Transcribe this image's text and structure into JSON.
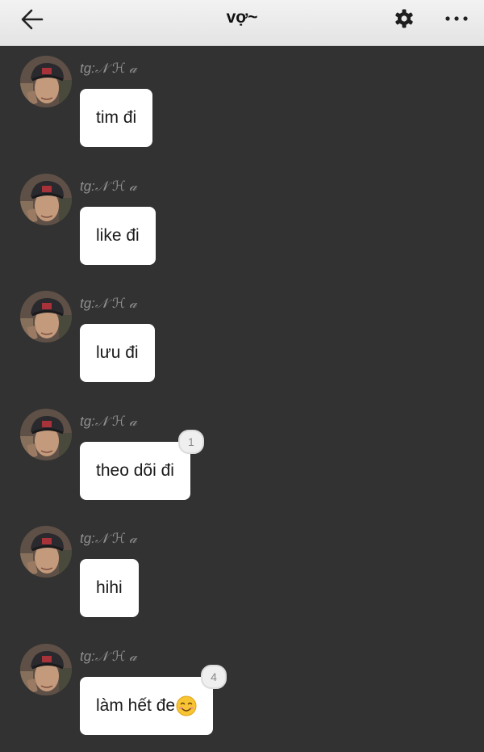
{
  "header": {
    "back_icon": "arrow-left-icon",
    "title": "vợ~",
    "settings_icon": "gear-icon",
    "more_icon": "more-dots-icon"
  },
  "messages": [
    {
      "sender": "tg:𝒩 ℋ 𝒶",
      "text": "tim đi",
      "reactions": null
    },
    {
      "sender": "tg:𝒩 ℋ 𝒶",
      "text": "like đi",
      "reactions": null
    },
    {
      "sender": "tg:𝒩 ℋ 𝒶",
      "text": "lưu đi",
      "reactions": null
    },
    {
      "sender": "tg:𝒩 ℋ 𝒶",
      "text": "theo dõi đi",
      "reactions": "1"
    },
    {
      "sender": "tg:𝒩 ℋ 𝒶",
      "text": "hihi",
      "reactions": null
    },
    {
      "sender": "tg:𝒩 ℋ 𝒶",
      "text": "làm hết đe",
      "emoji": "smiling-face-emoji",
      "reactions": "4"
    }
  ],
  "colors": {
    "background": "#323232",
    "header": "#ececec",
    "bubble": "#ffffff",
    "sender": "#8f8f8f"
  }
}
